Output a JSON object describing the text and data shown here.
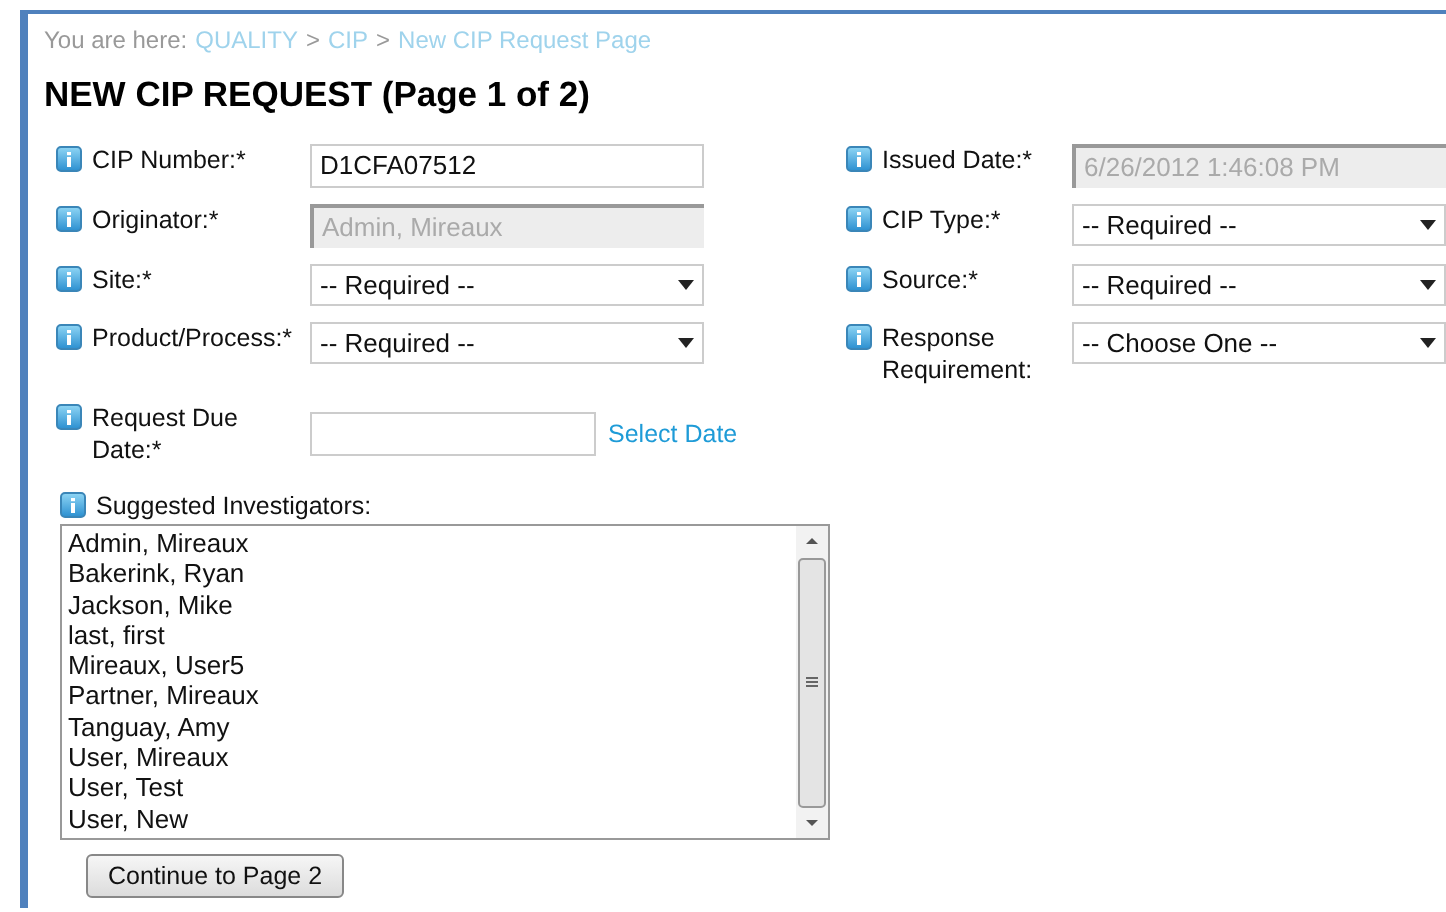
{
  "breadcrumb": [
    {
      "kind": "text",
      "text": "You are here:"
    },
    {
      "kind": "link",
      "text": "QUALITY"
    },
    {
      "kind": "sep",
      "text": ">"
    },
    {
      "kind": "link",
      "text": "CIP"
    },
    {
      "kind": "sep",
      "text": ">"
    },
    {
      "kind": "link",
      "text": "New CIP Request Page"
    }
  ],
  "title": "NEW CIP REQUEST (Page 1 of 2)",
  "rows": [
    {
      "left": {
        "label": "CIP Number:*",
        "kind": "text",
        "value": "D1CFA07512",
        "disabled": false
      },
      "right": {
        "label": "Issued Date:*",
        "kind": "text",
        "value": "6/26/2012 1:46:08 PM",
        "disabled": true
      }
    },
    {
      "left": {
        "label": "Originator:*",
        "kind": "text",
        "value": "Admin, Mireaux",
        "disabled": true
      },
      "right": {
        "label": "CIP Type:*",
        "kind": "select",
        "value": "-- Required --"
      }
    },
    {
      "left": {
        "label": "Site:*",
        "kind": "select",
        "value": "-- Required --"
      },
      "right": {
        "label": "Source:*",
        "kind": "select",
        "value": "-- Required --"
      }
    },
    {
      "left": {
        "label": "Product/Process:*",
        "kind": "select",
        "value": "-- Required --"
      },
      "right": {
        "label": "Response Requirement:",
        "kind": "select",
        "value": "-- Choose One --"
      }
    },
    {
      "left": {
        "label": "Request Due Date:*",
        "kind": "date",
        "link": "Select Date"
      }
    }
  ],
  "investigators": {
    "label": "Suggested Investigators:",
    "items": [
      "Admin, Mireaux",
      "Bakerink, Ryan",
      "Jackson, Mike",
      "last, first",
      "Mireaux, User5",
      "Partner, Mireaux",
      "Tanguay, Amy",
      "User, Mireaux",
      "User, Test",
      "User, New"
    ]
  },
  "button": "Continue to Page 2"
}
